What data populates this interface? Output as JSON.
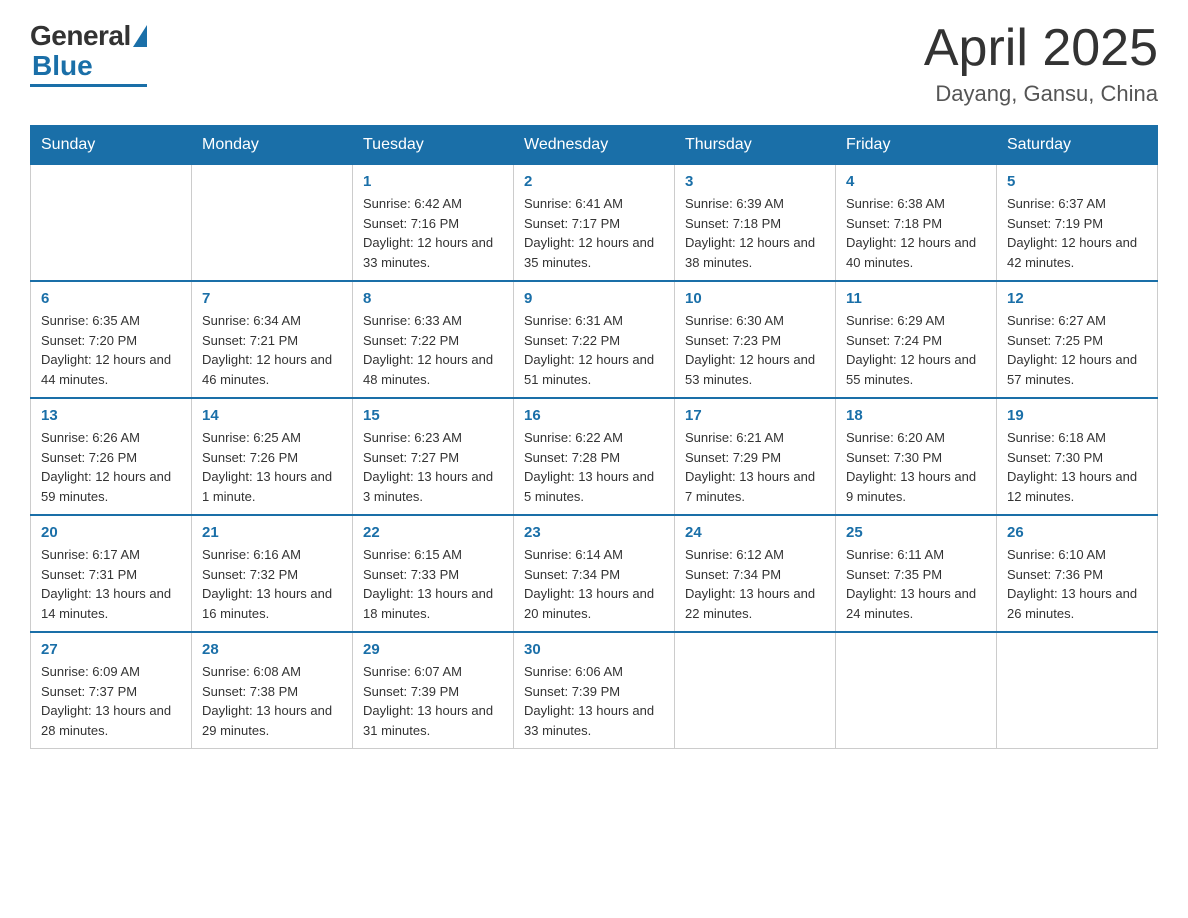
{
  "header": {
    "logo_general": "General",
    "logo_blue": "Blue",
    "month_title": "April 2025",
    "location": "Dayang, Gansu, China"
  },
  "days_of_week": [
    "Sunday",
    "Monday",
    "Tuesday",
    "Wednesday",
    "Thursday",
    "Friday",
    "Saturday"
  ],
  "weeks": [
    [
      null,
      null,
      {
        "day": "1",
        "sunrise": "6:42 AM",
        "sunset": "7:16 PM",
        "daylight": "12 hours and 33 minutes."
      },
      {
        "day": "2",
        "sunrise": "6:41 AM",
        "sunset": "7:17 PM",
        "daylight": "12 hours and 35 minutes."
      },
      {
        "day": "3",
        "sunrise": "6:39 AM",
        "sunset": "7:18 PM",
        "daylight": "12 hours and 38 minutes."
      },
      {
        "day": "4",
        "sunrise": "6:38 AM",
        "sunset": "7:18 PM",
        "daylight": "12 hours and 40 minutes."
      },
      {
        "day": "5",
        "sunrise": "6:37 AM",
        "sunset": "7:19 PM",
        "daylight": "12 hours and 42 minutes."
      }
    ],
    [
      {
        "day": "6",
        "sunrise": "6:35 AM",
        "sunset": "7:20 PM",
        "daylight": "12 hours and 44 minutes."
      },
      {
        "day": "7",
        "sunrise": "6:34 AM",
        "sunset": "7:21 PM",
        "daylight": "12 hours and 46 minutes."
      },
      {
        "day": "8",
        "sunrise": "6:33 AM",
        "sunset": "7:22 PM",
        "daylight": "12 hours and 48 minutes."
      },
      {
        "day": "9",
        "sunrise": "6:31 AM",
        "sunset": "7:22 PM",
        "daylight": "12 hours and 51 minutes."
      },
      {
        "day": "10",
        "sunrise": "6:30 AM",
        "sunset": "7:23 PM",
        "daylight": "12 hours and 53 minutes."
      },
      {
        "day": "11",
        "sunrise": "6:29 AM",
        "sunset": "7:24 PM",
        "daylight": "12 hours and 55 minutes."
      },
      {
        "day": "12",
        "sunrise": "6:27 AM",
        "sunset": "7:25 PM",
        "daylight": "12 hours and 57 minutes."
      }
    ],
    [
      {
        "day": "13",
        "sunrise": "6:26 AM",
        "sunset": "7:26 PM",
        "daylight": "12 hours and 59 minutes."
      },
      {
        "day": "14",
        "sunrise": "6:25 AM",
        "sunset": "7:26 PM",
        "daylight": "13 hours and 1 minute."
      },
      {
        "day": "15",
        "sunrise": "6:23 AM",
        "sunset": "7:27 PM",
        "daylight": "13 hours and 3 minutes."
      },
      {
        "day": "16",
        "sunrise": "6:22 AM",
        "sunset": "7:28 PM",
        "daylight": "13 hours and 5 minutes."
      },
      {
        "day": "17",
        "sunrise": "6:21 AM",
        "sunset": "7:29 PM",
        "daylight": "13 hours and 7 minutes."
      },
      {
        "day": "18",
        "sunrise": "6:20 AM",
        "sunset": "7:30 PM",
        "daylight": "13 hours and 9 minutes."
      },
      {
        "day": "19",
        "sunrise": "6:18 AM",
        "sunset": "7:30 PM",
        "daylight": "13 hours and 12 minutes."
      }
    ],
    [
      {
        "day": "20",
        "sunrise": "6:17 AM",
        "sunset": "7:31 PM",
        "daylight": "13 hours and 14 minutes."
      },
      {
        "day": "21",
        "sunrise": "6:16 AM",
        "sunset": "7:32 PM",
        "daylight": "13 hours and 16 minutes."
      },
      {
        "day": "22",
        "sunrise": "6:15 AM",
        "sunset": "7:33 PM",
        "daylight": "13 hours and 18 minutes."
      },
      {
        "day": "23",
        "sunrise": "6:14 AM",
        "sunset": "7:34 PM",
        "daylight": "13 hours and 20 minutes."
      },
      {
        "day": "24",
        "sunrise": "6:12 AM",
        "sunset": "7:34 PM",
        "daylight": "13 hours and 22 minutes."
      },
      {
        "day": "25",
        "sunrise": "6:11 AM",
        "sunset": "7:35 PM",
        "daylight": "13 hours and 24 minutes."
      },
      {
        "day": "26",
        "sunrise": "6:10 AM",
        "sunset": "7:36 PM",
        "daylight": "13 hours and 26 minutes."
      }
    ],
    [
      {
        "day": "27",
        "sunrise": "6:09 AM",
        "sunset": "7:37 PM",
        "daylight": "13 hours and 28 minutes."
      },
      {
        "day": "28",
        "sunrise": "6:08 AM",
        "sunset": "7:38 PM",
        "daylight": "13 hours and 29 minutes."
      },
      {
        "day": "29",
        "sunrise": "6:07 AM",
        "sunset": "7:39 PM",
        "daylight": "13 hours and 31 minutes."
      },
      {
        "day": "30",
        "sunrise": "6:06 AM",
        "sunset": "7:39 PM",
        "daylight": "13 hours and 33 minutes."
      },
      null,
      null,
      null
    ]
  ]
}
